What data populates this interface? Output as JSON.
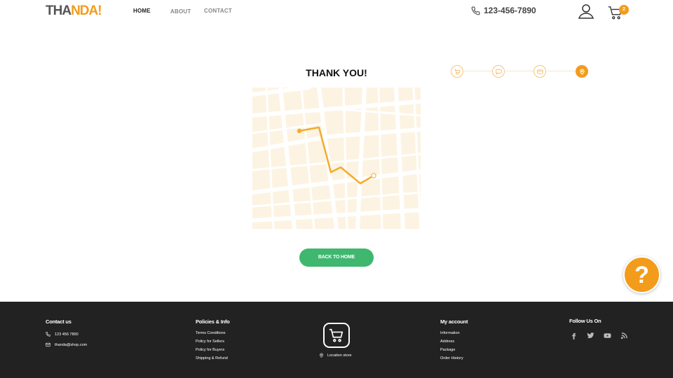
{
  "header": {
    "logo": {
      "part1": "THA",
      "part2": "NDA!"
    },
    "nav": [
      {
        "label": "HOME",
        "active": true
      },
      {
        "label": "ABOUT",
        "active": false
      },
      {
        "label": "CONTACT",
        "active": false
      }
    ],
    "phone": "123-456-7890",
    "cart_count": "2"
  },
  "main": {
    "title": "THANK YOU!",
    "steps": [
      {
        "icon": "cart-icon",
        "done": false
      },
      {
        "icon": "chat-icon",
        "done": false
      },
      {
        "icon": "payment-icon",
        "done": false
      },
      {
        "icon": "location-pin-icon",
        "done": true
      }
    ],
    "back_button": "BACK TO HOME",
    "help_label": "?"
  },
  "footer": {
    "contact": {
      "title": "Contact us",
      "phone": "123 456 7890",
      "email": "thanda@shop.com"
    },
    "policies": {
      "title": "Policies & Info",
      "items": [
        "Terms Conditions",
        "Policy for Sellers",
        "Policy for Buyers",
        "Shipping & Refund"
      ]
    },
    "store": {
      "label": "Location store"
    },
    "account": {
      "title": "My account",
      "items": [
        "Information",
        "Address",
        "Package",
        "Order History"
      ]
    },
    "follow": {
      "title": "Follow Us On",
      "icons": [
        "facebook-icon",
        "twitter-icon",
        "youtube-icon",
        "rss-icon"
      ]
    }
  },
  "colors": {
    "accent": "#f39c1b",
    "button": "#3fb76f",
    "footer_bg": "#222222",
    "map_bg": "#fdf3e2"
  }
}
